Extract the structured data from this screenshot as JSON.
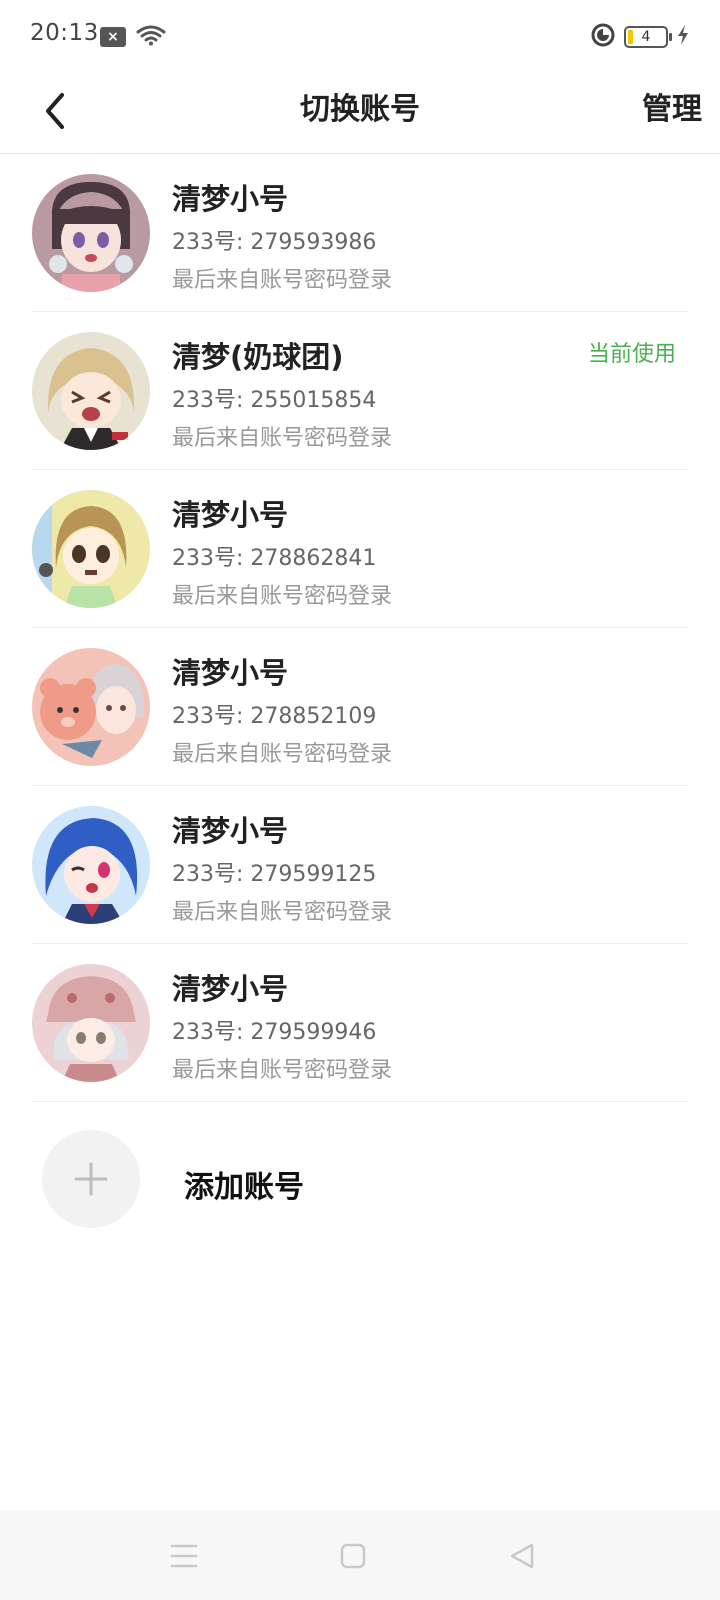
{
  "status_bar": {
    "time": "20:13",
    "notification_icon": "×",
    "battery_level": "4",
    "icons": [
      "notification-icon",
      "wifi-icon",
      "data-saver-icon",
      "battery-icon",
      "charging-icon"
    ]
  },
  "header": {
    "title": "切换账号",
    "manage_label": "管理",
    "back_icon": "chevron-left-icon"
  },
  "accounts": [
    {
      "name": "清梦小号",
      "id_line": "233号: 279593986",
      "login_line": "最后来自账号密码登录",
      "current_label": "",
      "avatar_bg": "#b89aa0"
    },
    {
      "name": "清梦(奶球团)",
      "id_line": "233号: 255015854",
      "login_line": "最后来自账号密码登录",
      "current_label": "当前使用",
      "avatar_bg": "#d9ccb4"
    },
    {
      "name": "清梦小号",
      "id_line": "233号: 278862841",
      "login_line": "最后来自账号密码登录",
      "current_label": "",
      "avatar_bg": "#e9e19a"
    },
    {
      "name": "清梦小号",
      "id_line": "233号: 278852109",
      "login_line": "最后来自账号密码登录",
      "current_label": "",
      "avatar_bg": "#f0b5aa"
    },
    {
      "name": "清梦小号",
      "id_line": "233号: 279599125",
      "login_line": "最后来自账号密码登录",
      "current_label": "",
      "avatar_bg": "#5a8fd8"
    },
    {
      "name": "清梦小号",
      "id_line": "233号: 279599946",
      "login_line": "最后来自账号密码登录",
      "current_label": "",
      "avatar_bg": "#e6c9cb"
    }
  ],
  "add_account": {
    "label": "添加账号",
    "icon": "plus-icon"
  },
  "nav_bar": {
    "icons": [
      "menu-icon",
      "home-square-icon",
      "back-triangle-icon"
    ]
  },
  "colors": {
    "current_tag": "#4caf50",
    "divider": "#ececec",
    "nav_bg": "#f7f7f7"
  }
}
